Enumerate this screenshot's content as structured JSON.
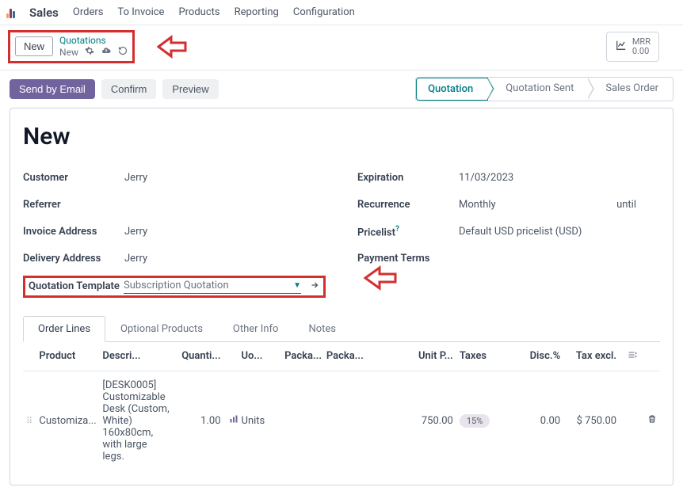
{
  "top_menu": {
    "active": "Sales",
    "items": [
      "Orders",
      "To Invoice",
      "Products",
      "Reporting",
      "Configuration"
    ]
  },
  "breadcrumb": {
    "new_button": "New",
    "parent": "Quotations",
    "current": "New"
  },
  "mrr": {
    "label": "MRR",
    "value": "0.00"
  },
  "actions": {
    "send_email": "Send by Email",
    "confirm": "Confirm",
    "preview": "Preview"
  },
  "status": {
    "quotation": "Quotation",
    "quotation_sent": "Quotation Sent",
    "sales_order": "Sales Order"
  },
  "form": {
    "title": "New",
    "labels": {
      "customer": "Customer",
      "referrer": "Referrer",
      "invoice_address": "Invoice Address",
      "delivery_address": "Delivery Address",
      "quotation_template": "Quotation Template",
      "expiration": "Expiration",
      "recurrence": "Recurrence",
      "until": "until",
      "pricelist": "Pricelist",
      "pricelist_sup": "?",
      "payment_terms": "Payment Terms"
    },
    "values": {
      "customer": "Jerry",
      "referrer": "",
      "invoice_address": "Jerry",
      "delivery_address": "Jerry",
      "quotation_template": "Subscription Quotation",
      "expiration": "11/03/2023",
      "recurrence": "Monthly",
      "pricelist": "Default USD pricelist (USD)",
      "payment_terms": ""
    }
  },
  "tabs": {
    "order_lines": "Order Lines",
    "optional_products": "Optional Products",
    "other_info": "Other Info",
    "notes": "Notes"
  },
  "table": {
    "headers": {
      "product": "Product",
      "description": "Descri...",
      "quantity": "Quanti...",
      "uom": "Uo...",
      "packaging1": "Packa...",
      "packaging2": "Packa...",
      "unit_price": "Unit P...",
      "taxes": "Taxes",
      "disc": "Disc.%",
      "tax_excl": "Tax excl."
    },
    "rows": [
      {
        "product": "Customiza...",
        "description": "[DESK0005] Customizable Desk (Custom, White) 160x80cm, with large legs.",
        "quantity": "1.00",
        "uom": "Units",
        "unit_price": "750.00",
        "taxes": "15%",
        "disc": "0.00",
        "tax_excl": "$ 750.00"
      }
    ]
  }
}
